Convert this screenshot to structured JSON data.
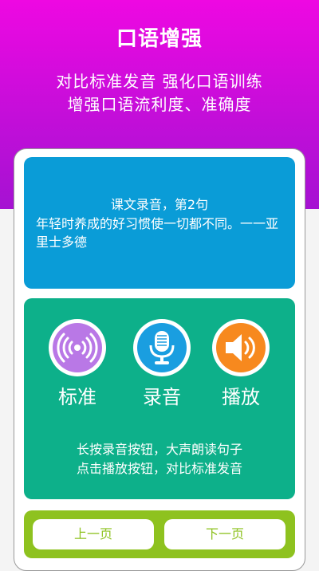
{
  "header": {
    "title": "口语增强",
    "subtitle_line1": "对比标准发音 强化口语训练",
    "subtitle_line2": "增强口语流利度、准确度"
  },
  "sentence": {
    "heading": "课文录音，第2句",
    "text": "年轻时养成的好习惯使一切都不同。一一亚里士多德"
  },
  "controls": [
    {
      "label": "标准",
      "icon": "broadcast-icon",
      "color": "#b978e6"
    },
    {
      "label": "录音",
      "icon": "microphone-icon",
      "color": "#1a9ee0"
    },
    {
      "label": "播放",
      "icon": "speaker-icon",
      "color": "#f7891e"
    }
  ],
  "hints": {
    "line1": "长按录音按钮，大声朗读句子",
    "line2": "点击播放按钮，对比标准发音"
  },
  "nav": {
    "prev_label": "上一页",
    "next_label": "下一页"
  },
  "colors": {
    "header_gradient_top": "#ee08e2",
    "header_gradient_bottom": "#a512d2",
    "sentence_panel": "#0a9cd7",
    "control_panel": "#0db08a",
    "nav_bar": "#8ec21f"
  }
}
